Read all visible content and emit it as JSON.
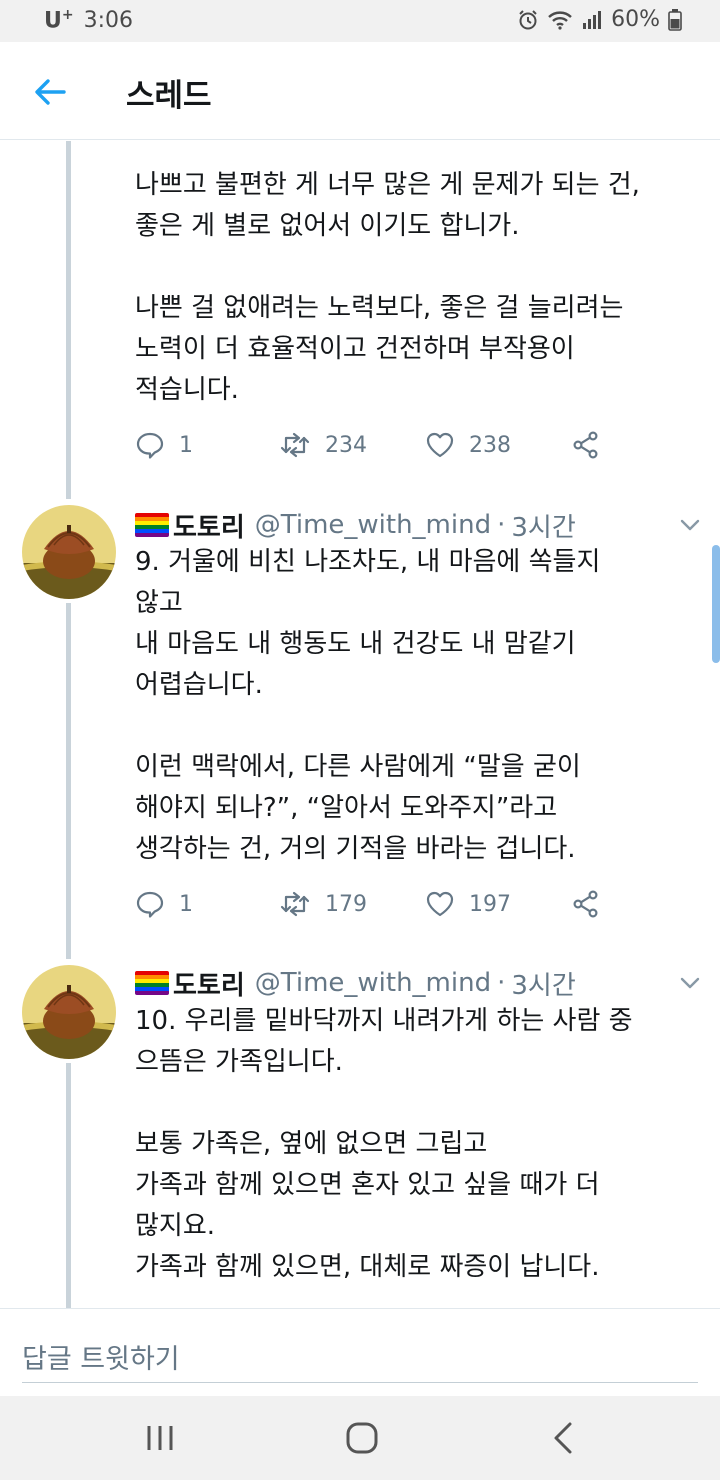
{
  "status_bar": {
    "carrier": "U",
    "carrier_sup": "+",
    "time": "3:06",
    "battery": "60%",
    "icons": [
      "alarm-icon",
      "wifi-icon",
      "signal-icon",
      "battery-icon"
    ]
  },
  "header": {
    "title": "스레드",
    "back_icon": "arrow-left-icon"
  },
  "tweets": [
    {
      "text": "나쁘고 불편한 게 너무 많은 게 문제가 되는 건,\n좋은 게 별로 없어서 이기도 합니가.\n\n나쁜 걸 없애려는 노력보다, 좋은 걸 늘리려는\n노력이 더 효율적이고 건전하며 부작용이\n적습니다.",
      "replies": "1",
      "retweets": "234",
      "likes": "238"
    },
    {
      "name": "도토리",
      "handle": "@Time_with_mind",
      "sep": "·",
      "time": "3시간",
      "text": "9. 거울에 비친 나조차도, 내 마음에 쏙들지\n않고\n내 마음도 내 행동도 내 건강도 내 맘같기\n어렵습니다.\n\n이런 맥락에서, 다른 사람에게 “말을 굳이\n해야지 되나?”, “알아서 도와주지”라고\n생각하는 건, 거의 기적을 바라는 겁니다.",
      "replies": "1",
      "retweets": "179",
      "likes": "197"
    },
    {
      "name": "도토리",
      "handle": "@Time_with_mind",
      "sep": "·",
      "time": "3시간",
      "text": "10. 우리를 밑바닥까지 내려가게 하는 사람 중\n으뜸은 가족입니다.\n\n보통 가족은, 옆에 없으면 그립고\n가족과 함께 있으면 혼자 있고 싶을 때가 더\n많지요.\n가족과 함께 있으면, 대체로 짜증이 납니다."
    }
  ],
  "reply_bar": {
    "placeholder": "답글 트윗하기"
  },
  "colors": {
    "accent": "#1da1f2",
    "secondary_text": "#657786",
    "thread_line": "#c9d3da"
  }
}
